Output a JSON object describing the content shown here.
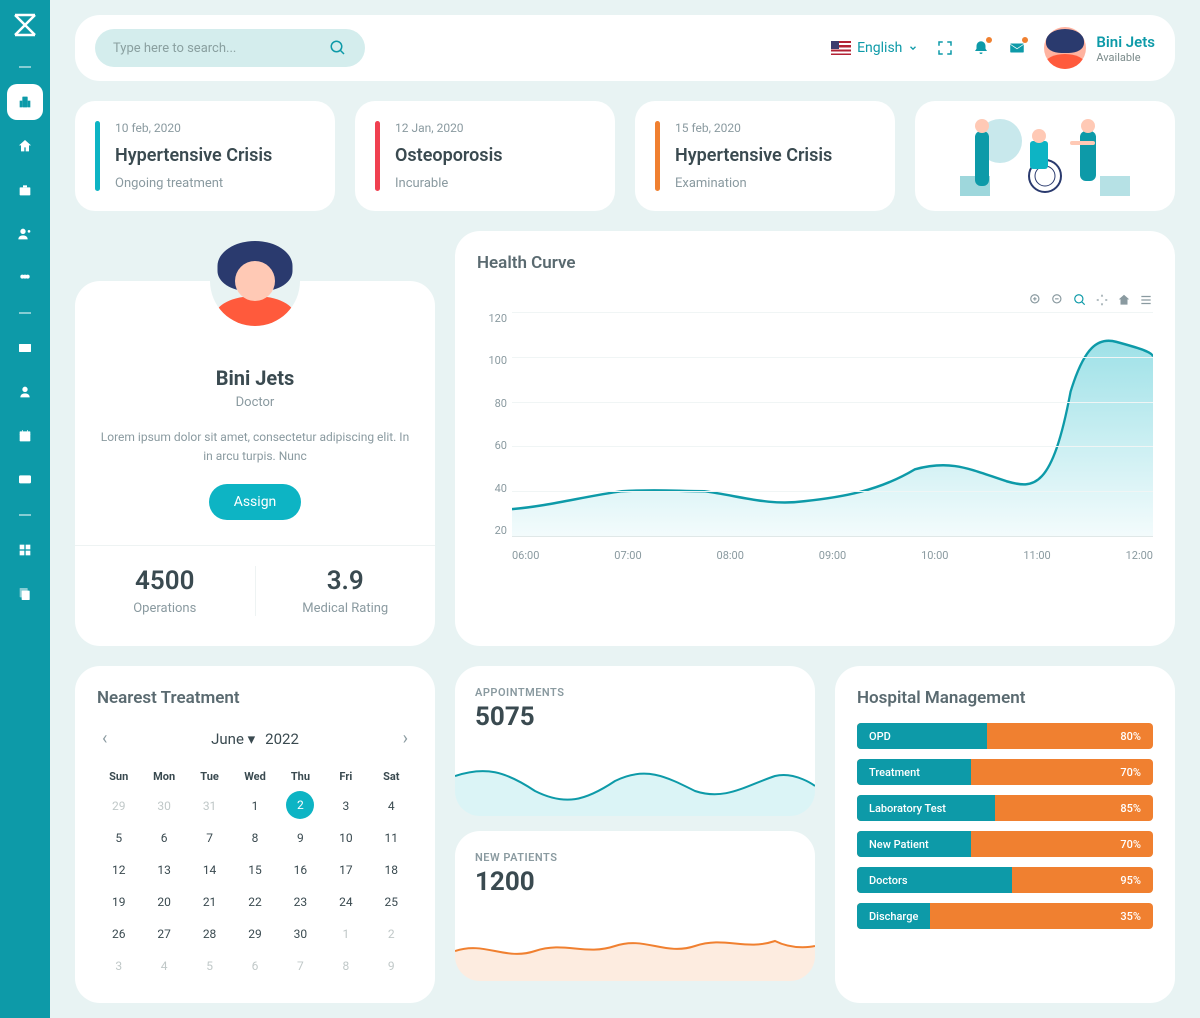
{
  "search": {
    "placeholder": "Type here to search..."
  },
  "language": {
    "label": "English"
  },
  "user": {
    "name": "Bini Jets",
    "status": "Available"
  },
  "diagnoses": [
    {
      "date": "10 feb, 2020",
      "title": "Hypertensive Crisis",
      "status": "Ongoing treatment",
      "color": "#0db4c4"
    },
    {
      "date": "12 Jan, 2020",
      "title": "Osteoporosis",
      "status": "Incurable",
      "color": "#f04050"
    },
    {
      "date": "15 feb, 2020",
      "title": "Hypertensive Crisis",
      "status": "Examination",
      "color": "#f08030"
    }
  ],
  "profile": {
    "name": "Bini Jets",
    "role": "Doctor",
    "desc": "Lorem ipsum dolor sit amet, consectetur adipiscing elit. In in arcu turpis. Nunc",
    "assign": "Assign",
    "stats": [
      {
        "value": "4500",
        "label": "Operations"
      },
      {
        "value": "3.9",
        "label": "Medical Rating"
      }
    ]
  },
  "healthCurve": {
    "title": "Health Curve"
  },
  "chart_data": {
    "type": "area",
    "title": "Health Curve",
    "x": [
      "06:00",
      "07:00",
      "08:00",
      "09:00",
      "10:00",
      "11:00",
      "12:00"
    ],
    "y_ticks": [
      20,
      40,
      60,
      80,
      100,
      120
    ],
    "ylim": [
      20,
      120
    ],
    "series": [
      {
        "name": "Health",
        "values": [
          32,
          38,
          40,
          35,
          38,
          50,
          44,
          42,
          108,
          102,
          100
        ]
      }
    ]
  },
  "treatment": {
    "title": "Nearest Treatment",
    "month": "June",
    "year": "2022",
    "days": [
      "Sun",
      "Mon",
      "Tue",
      "Wed",
      "Thu",
      "Fri",
      "Sat"
    ],
    "grid": [
      [
        {
          "d": 29,
          "o": true
        },
        {
          "d": 30,
          "o": true
        },
        {
          "d": 31,
          "o": true
        },
        {
          "d": 1
        },
        {
          "d": 2,
          "a": true
        },
        {
          "d": 3
        },
        {
          "d": 4
        }
      ],
      [
        {
          "d": 5
        },
        {
          "d": 6
        },
        {
          "d": 7
        },
        {
          "d": 8
        },
        {
          "d": 9
        },
        {
          "d": 10
        },
        {
          "d": 11
        }
      ],
      [
        {
          "d": 12
        },
        {
          "d": 13
        },
        {
          "d": 14
        },
        {
          "d": 15
        },
        {
          "d": 16
        },
        {
          "d": 17
        },
        {
          "d": 18
        }
      ],
      [
        {
          "d": 19
        },
        {
          "d": 20
        },
        {
          "d": 21
        },
        {
          "d": 22
        },
        {
          "d": 23
        },
        {
          "d": 24
        },
        {
          "d": 25
        }
      ],
      [
        {
          "d": 26
        },
        {
          "d": 27
        },
        {
          "d": 28
        },
        {
          "d": 29
        },
        {
          "d": 30
        },
        {
          "d": 1,
          "o": true
        },
        {
          "d": 2,
          "o": true
        }
      ],
      [
        {
          "d": 3,
          "o": true
        },
        {
          "d": 4,
          "o": true
        },
        {
          "d": 5,
          "o": true
        },
        {
          "d": 6,
          "o": true
        },
        {
          "d": 7,
          "o": true
        },
        {
          "d": 8,
          "o": true
        },
        {
          "d": 9,
          "o": true
        }
      ]
    ]
  },
  "appointments": {
    "label": "APPOINTMENTS",
    "value": "5075"
  },
  "newPatients": {
    "label": "NEW PATIENTS",
    "value": "1200"
  },
  "hospital": {
    "title": "Hospital Management",
    "bars": [
      {
        "name": "OPD",
        "pct": 80
      },
      {
        "name": "Treatment",
        "pct": 70
      },
      {
        "name": "Laboratory Test",
        "pct": 85
      },
      {
        "name": "New Patient",
        "pct": 70
      },
      {
        "name": "Doctors",
        "pct": 95
      },
      {
        "name": "Discharge",
        "pct": 35
      }
    ]
  }
}
